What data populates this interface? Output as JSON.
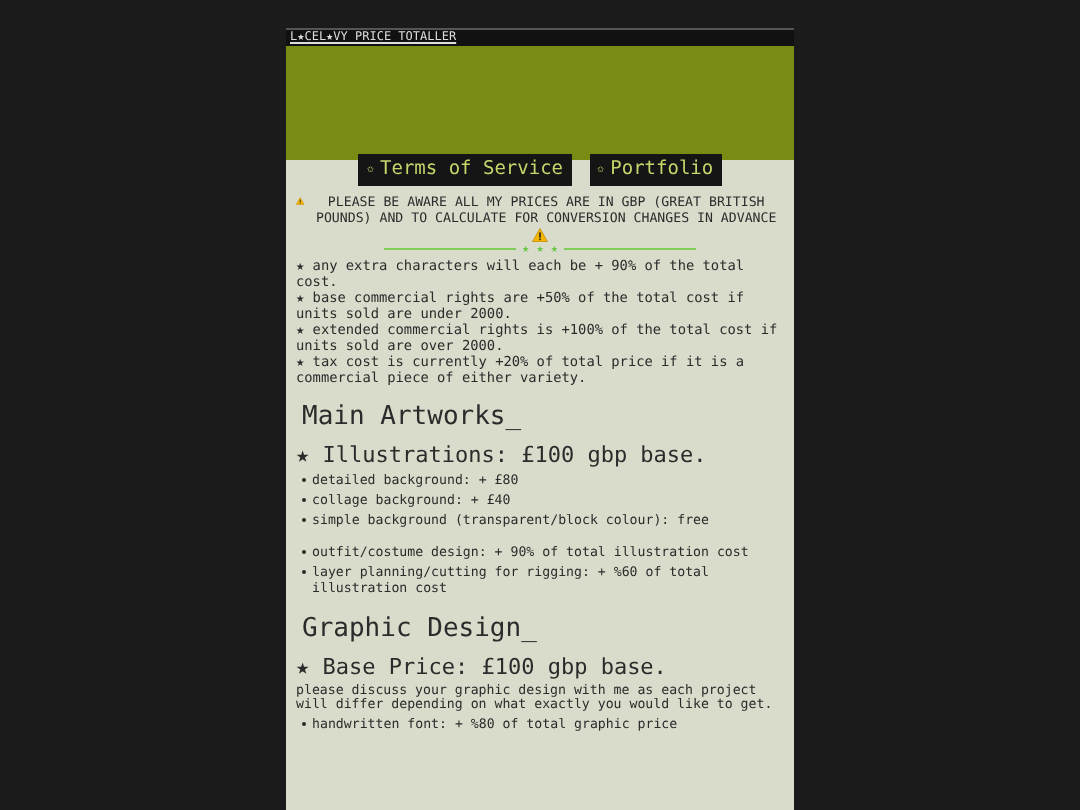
{
  "window": {
    "title": "L★CEL★VY PRICE TOTALLER"
  },
  "nav": [
    {
      "bullet": "✩",
      "label": "Terms of Service"
    },
    {
      "bullet": "✩",
      "label": "Portfolio"
    }
  ],
  "notice": {
    "text": "PLEASE BE AWARE ALL MY PRICES ARE IN GBP (GREAT BRITISH POUNDS) AND TO CALCULATE FOR CONVERSION CHANGES IN ADVANCE"
  },
  "divider": {
    "stars": "★ ★ ★"
  },
  "rules": [
    "★ any extra characters will each be + 90% of the total cost.",
    "★ base commercial rights are +50% of the total cost if units sold are under 2000.",
    "★ extended commercial rights is +100% of the total cost if units sold are over 2000.",
    "★ tax cost is currently +20% of total price if it is a commercial piece of either variety."
  ],
  "sections": [
    {
      "heading": "Main Artworks_",
      "subheading": "★ Illustrations: £100 gbp base.",
      "groups": [
        [
          "detailed background: + £80",
          "collage background: + £40",
          "simple background (transparent/block colour): free"
        ],
        [
          "outfit/costume design: + 90% of total illustration cost",
          "layer planning/cutting for rigging: + %60 of total illustration cost"
        ]
      ]
    },
    {
      "heading": "Graphic Design_",
      "subheading": "★ Base Price: £100 gbp base.",
      "intro": "please discuss your graphic design with me as each project will differ depending on what exactly you would like to get.",
      "groups": [
        [
          "handwritten font: + %80 of total graphic price"
        ]
      ]
    }
  ]
}
